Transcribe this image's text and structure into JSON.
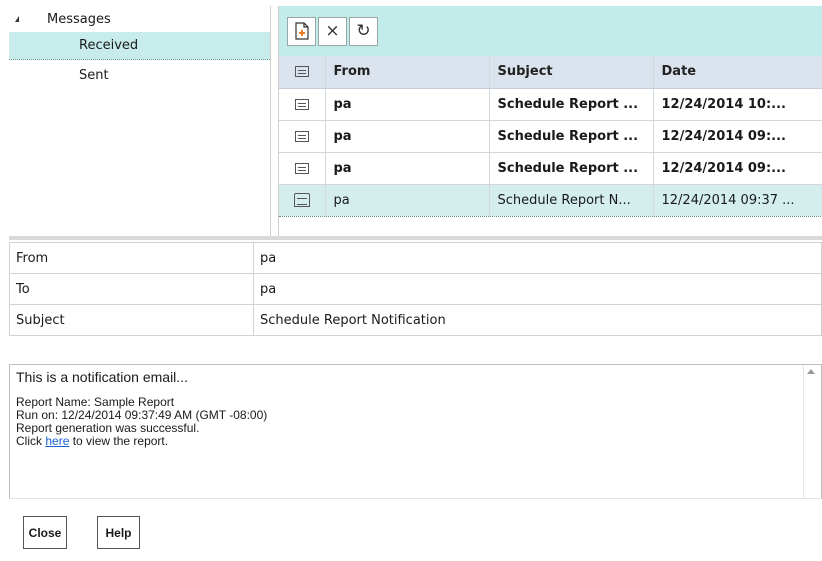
{
  "tree": {
    "root_label": "Messages",
    "items": [
      {
        "label": "Received",
        "selected": true
      },
      {
        "label": "Sent",
        "selected": false
      }
    ]
  },
  "toolbar": {
    "new_icon": "new-page-icon",
    "delete_icon": "close-icon",
    "refresh_icon": "refresh-icon",
    "delete_glyph": "×",
    "refresh_glyph": "↻"
  },
  "messages": {
    "columns": [
      "From",
      "Subject",
      "Date"
    ],
    "rows": [
      {
        "from": "pa",
        "subject": "Schedule Report ...",
        "date": "12/24/2014 10:...",
        "unread": true
      },
      {
        "from": "pa",
        "subject": "Schedule Report ...",
        "date": "12/24/2014 09:...",
        "unread": true
      },
      {
        "from": "pa",
        "subject": "Schedule Report ...",
        "date": "12/24/2014 09:...",
        "unread": true
      },
      {
        "from": "pa",
        "subject": "Schedule Report N...",
        "date": "12/24/2014 09:37 ...",
        "unread": false
      }
    ]
  },
  "details": {
    "from_label": "From",
    "from_value": "pa",
    "to_label": "To",
    "to_value": "pa",
    "subject_label": "Subject",
    "subject_value": "Schedule Report Notification"
  },
  "body": {
    "intro": "This is a notification email...",
    "report_name": "Report Name: Sample Report",
    "run_on": "Run on: 12/24/2014 09:37:49 AM (GMT -08:00)",
    "status": "Report generation was successful.",
    "click_prefix": "Click ",
    "link_text": "here",
    "click_suffix": " to view the report."
  },
  "footer": {
    "close_label": "Close",
    "help_label": "Help"
  },
  "colors": {
    "toolbar_bg": "#c2ecea",
    "selected_bg": "#c8ecec",
    "header_bg": "#dbe4ee",
    "link": "#1a5fd0"
  }
}
